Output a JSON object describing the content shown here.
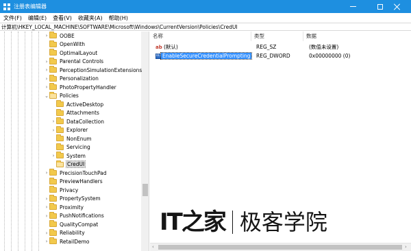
{
  "window": {
    "title": "注册表编辑器"
  },
  "menu": [
    "文件(F)",
    "编辑(E)",
    "查看(V)",
    "收藏夹(A)",
    "帮助(H)"
  ],
  "address": "计算机\\HKEY_LOCAL_MACHINE\\SOFTWARE\\Microsoft\\Windows\\CurrentVersion\\Policies\\CredUI",
  "tree": {
    "items": [
      {
        "label": "OOBE",
        "level": 0,
        "expander": "›"
      },
      {
        "label": "OpenWith",
        "level": 0,
        "expander": ""
      },
      {
        "label": "OptimalLayout",
        "level": 0,
        "expander": ""
      },
      {
        "label": "Parental Controls",
        "level": 0,
        "expander": "›"
      },
      {
        "label": "PerceptionSimulationExtensions",
        "level": 0,
        "expander": "›"
      },
      {
        "label": "Personalization",
        "level": 0,
        "expander": "›"
      },
      {
        "label": "PhotoPropertyHandler",
        "level": 0,
        "expander": "›"
      },
      {
        "label": "Policies",
        "level": 0,
        "expander": "⌄",
        "open": true
      },
      {
        "label": "ActiveDesktop",
        "level": 1,
        "expander": ""
      },
      {
        "label": "Attachments",
        "level": 1,
        "expander": ""
      },
      {
        "label": "DataCollection",
        "level": 1,
        "expander": "›"
      },
      {
        "label": "Explorer",
        "level": 1,
        "expander": "›"
      },
      {
        "label": "NonEnum",
        "level": 1,
        "expander": ""
      },
      {
        "label": "Servicing",
        "level": 1,
        "expander": ""
      },
      {
        "label": "System",
        "level": 1,
        "expander": "›"
      },
      {
        "label": "CredUI",
        "level": 1,
        "expander": "",
        "selected": true
      },
      {
        "label": "PrecisionTouchPad",
        "level": 0,
        "expander": "›"
      },
      {
        "label": "PreviewHandlers",
        "level": 0,
        "expander": ""
      },
      {
        "label": "Privacy",
        "level": 0,
        "expander": ""
      },
      {
        "label": "PropertySystem",
        "level": 0,
        "expander": "›"
      },
      {
        "label": "Proximity",
        "level": 0,
        "expander": "›"
      },
      {
        "label": "PushNotifications",
        "level": 0,
        "expander": "›"
      },
      {
        "label": "QualityCompat",
        "level": 0,
        "expander": ""
      },
      {
        "label": "Reliability",
        "level": 0,
        "expander": "›"
      },
      {
        "label": "RetailDemo",
        "level": 0,
        "expander": "›"
      }
    ]
  },
  "values": {
    "headers": {
      "name": "名称",
      "type": "类型",
      "data": "数据"
    },
    "rows": [
      {
        "icon": "string-value-icon",
        "name": "(默认)",
        "type": "REG_SZ",
        "data": "(数值未设置)"
      },
      {
        "icon": "dword-value-icon",
        "name": "EnableSecureCredentialPrompting",
        "type": "REG_DWORD",
        "data": "0x00000000 (0)",
        "selected": true
      }
    ]
  },
  "watermark": {
    "logo": "IT之家",
    "name": "极客学院"
  }
}
